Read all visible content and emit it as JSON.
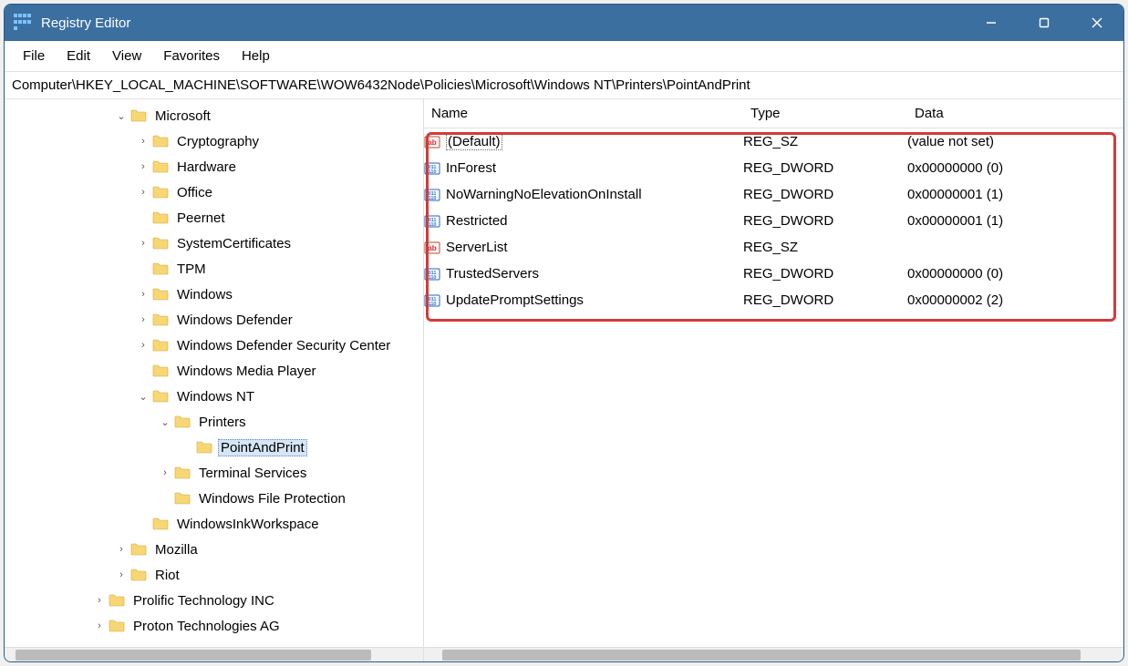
{
  "window": {
    "title": "Registry Editor"
  },
  "menu": [
    "File",
    "Edit",
    "View",
    "Favorites",
    "Help"
  ],
  "path": "Computer\\HKEY_LOCAL_MACHINE\\SOFTWARE\\WOW6432Node\\Policies\\Microsoft\\Windows NT\\Printers\\PointAndPrint",
  "tree": [
    {
      "indent": 5,
      "expander": "v",
      "label": "Microsoft"
    },
    {
      "indent": 6,
      "expander": ">",
      "label": "Cryptography"
    },
    {
      "indent": 6,
      "expander": ">",
      "label": "Hardware"
    },
    {
      "indent": 6,
      "expander": ">",
      "label": "Office"
    },
    {
      "indent": 6,
      "expander": "",
      "label": "Peernet"
    },
    {
      "indent": 6,
      "expander": ">",
      "label": "SystemCertificates"
    },
    {
      "indent": 6,
      "expander": "",
      "label": "TPM"
    },
    {
      "indent": 6,
      "expander": ">",
      "label": "Windows"
    },
    {
      "indent": 6,
      "expander": ">",
      "label": "Windows Defender"
    },
    {
      "indent": 6,
      "expander": ">",
      "label": "Windows Defender Security Center"
    },
    {
      "indent": 6,
      "expander": "",
      "label": "Windows Media Player"
    },
    {
      "indent": 6,
      "expander": "v",
      "label": "Windows NT"
    },
    {
      "indent": 7,
      "expander": "v",
      "label": "Printers"
    },
    {
      "indent": 8,
      "expander": "",
      "label": "PointAndPrint",
      "selected": true
    },
    {
      "indent": 7,
      "expander": ">",
      "label": "Terminal Services"
    },
    {
      "indent": 7,
      "expander": "",
      "label": "Windows File Protection"
    },
    {
      "indent": 6,
      "expander": "",
      "label": "WindowsInkWorkspace"
    },
    {
      "indent": 5,
      "expander": ">",
      "label": "Mozilla"
    },
    {
      "indent": 5,
      "expander": ">",
      "label": "Riot"
    },
    {
      "indent": 4,
      "expander": ">",
      "label": "Prolific Technology INC"
    },
    {
      "indent": 4,
      "expander": ">",
      "label": "Proton Technologies AG"
    }
  ],
  "columns": {
    "name": "Name",
    "type": "Type",
    "data": "Data"
  },
  "values": [
    {
      "icon": "sz",
      "name": "(Default)",
      "type": "REG_SZ",
      "data": "(value not set)",
      "focus": true
    },
    {
      "icon": "dword",
      "name": "InForest",
      "type": "REG_DWORD",
      "data": "0x00000000 (0)"
    },
    {
      "icon": "dword",
      "name": "NoWarningNoElevationOnInstall",
      "type": "REG_DWORD",
      "data": "0x00000001 (1)"
    },
    {
      "icon": "dword",
      "name": "Restricted",
      "type": "REG_DWORD",
      "data": "0x00000001 (1)"
    },
    {
      "icon": "sz",
      "name": "ServerList",
      "type": "REG_SZ",
      "data": ""
    },
    {
      "icon": "dword",
      "name": "TrustedServers",
      "type": "REG_DWORD",
      "data": "0x00000000 (0)"
    },
    {
      "icon": "dword",
      "name": "UpdatePromptSettings",
      "type": "REG_DWORD",
      "data": "0x00000002 (2)"
    }
  ]
}
